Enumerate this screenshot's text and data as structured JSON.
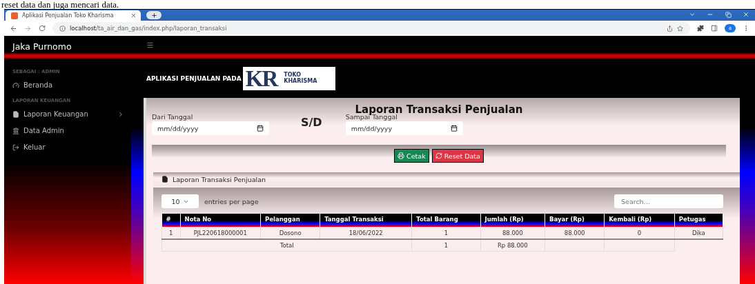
{
  "caption": "reset data dan juga mencari data.",
  "browser": {
    "tab_title": "Aplikasi Penjualan Toko Kharisma",
    "url_host": "localhost",
    "url_path": "/ta_air_dan_gas/index.php/laporan_transaksi",
    "profile": "a"
  },
  "topbar": {
    "user": "Jaka Purnomo"
  },
  "sidebar": {
    "sections": [
      {
        "heading": "SEBAGAI : ADMIN",
        "items": [
          {
            "label": "Beranda",
            "kind": "home",
            "has_submenu": false
          }
        ]
      },
      {
        "heading": "LAPORAN KEUANGAN",
        "items": [
          {
            "label": "Laporan Keuangan",
            "kind": "report",
            "has_submenu": true
          },
          {
            "label": "Data Admin",
            "kind": "admin",
            "has_submenu": false
          },
          {
            "label": "Keluar",
            "kind": "logout",
            "has_submenu": false
          }
        ]
      }
    ]
  },
  "header": {
    "text": "APLIKASI PENJUALAN PADA",
    "logo_letters": "KR",
    "logo_lines": [
      "TOKO",
      "KHARISMA"
    ]
  },
  "filter": {
    "title": "Laporan Transaksi Penjualan",
    "from": {
      "label": "Dari Tanggal",
      "placeholder": "mm/dd/yyyy"
    },
    "separator": "S/D",
    "to": {
      "label": "Sampai Tanggal",
      "placeholder": "mm/dd/yyyy"
    }
  },
  "buttons": [
    {
      "label": "Cetak",
      "kind": "print"
    },
    {
      "label": "Reset Data",
      "kind": "reset"
    }
  ],
  "report": {
    "title": "Laporan Transaksi Penjualan",
    "page_size": "10",
    "entries_label": "entries per page",
    "search_placeholder": "Search...",
    "columns": [
      "#",
      "Nota No",
      "Pelanggan",
      "Tanggal Transaksi",
      "Total Barang",
      "Jumlah (Rp)",
      "Bayar (Rp)",
      "Kembali (Rp)",
      "Petugas"
    ],
    "rows": [
      [
        "1",
        "PJL220618000001",
        "Dosono",
        "18/06/2022",
        "1",
        "88.000",
        "88.000",
        "0",
        "Dika"
      ]
    ],
    "total": {
      "label": "Total",
      "total_barang": "1",
      "jumlah": "Rp 88.000"
    }
  }
}
